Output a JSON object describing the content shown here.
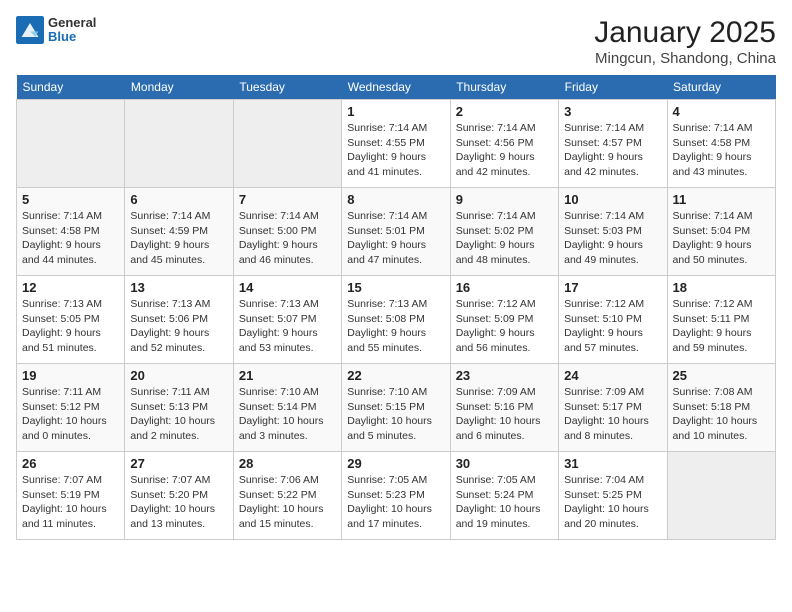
{
  "header": {
    "logo_general": "General",
    "logo_blue": "Blue",
    "month_title": "January 2025",
    "location": "Mingcun, Shandong, China"
  },
  "weekdays": [
    "Sunday",
    "Monday",
    "Tuesday",
    "Wednesday",
    "Thursday",
    "Friday",
    "Saturday"
  ],
  "weeks": [
    [
      {
        "day": "",
        "empty": true
      },
      {
        "day": "",
        "empty": true
      },
      {
        "day": "",
        "empty": true
      },
      {
        "day": "1",
        "sunrise": "7:14 AM",
        "sunset": "4:55 PM",
        "daylight": "9 hours and 41 minutes."
      },
      {
        "day": "2",
        "sunrise": "7:14 AM",
        "sunset": "4:56 PM",
        "daylight": "9 hours and 42 minutes."
      },
      {
        "day": "3",
        "sunrise": "7:14 AM",
        "sunset": "4:57 PM",
        "daylight": "9 hours and 42 minutes."
      },
      {
        "day": "4",
        "sunrise": "7:14 AM",
        "sunset": "4:58 PM",
        "daylight": "9 hours and 43 minutes."
      }
    ],
    [
      {
        "day": "5",
        "sunrise": "7:14 AM",
        "sunset": "4:58 PM",
        "daylight": "9 hours and 44 minutes."
      },
      {
        "day": "6",
        "sunrise": "7:14 AM",
        "sunset": "4:59 PM",
        "daylight": "9 hours and 45 minutes."
      },
      {
        "day": "7",
        "sunrise": "7:14 AM",
        "sunset": "5:00 PM",
        "daylight": "9 hours and 46 minutes."
      },
      {
        "day": "8",
        "sunrise": "7:14 AM",
        "sunset": "5:01 PM",
        "daylight": "9 hours and 47 minutes."
      },
      {
        "day": "9",
        "sunrise": "7:14 AM",
        "sunset": "5:02 PM",
        "daylight": "9 hours and 48 minutes."
      },
      {
        "day": "10",
        "sunrise": "7:14 AM",
        "sunset": "5:03 PM",
        "daylight": "9 hours and 49 minutes."
      },
      {
        "day": "11",
        "sunrise": "7:14 AM",
        "sunset": "5:04 PM",
        "daylight": "9 hours and 50 minutes."
      }
    ],
    [
      {
        "day": "12",
        "sunrise": "7:13 AM",
        "sunset": "5:05 PM",
        "daylight": "9 hours and 51 minutes."
      },
      {
        "day": "13",
        "sunrise": "7:13 AM",
        "sunset": "5:06 PM",
        "daylight": "9 hours and 52 minutes."
      },
      {
        "day": "14",
        "sunrise": "7:13 AM",
        "sunset": "5:07 PM",
        "daylight": "9 hours and 53 minutes."
      },
      {
        "day": "15",
        "sunrise": "7:13 AM",
        "sunset": "5:08 PM",
        "daylight": "9 hours and 55 minutes."
      },
      {
        "day": "16",
        "sunrise": "7:12 AM",
        "sunset": "5:09 PM",
        "daylight": "9 hours and 56 minutes."
      },
      {
        "day": "17",
        "sunrise": "7:12 AM",
        "sunset": "5:10 PM",
        "daylight": "9 hours and 57 minutes."
      },
      {
        "day": "18",
        "sunrise": "7:12 AM",
        "sunset": "5:11 PM",
        "daylight": "9 hours and 59 minutes."
      }
    ],
    [
      {
        "day": "19",
        "sunrise": "7:11 AM",
        "sunset": "5:12 PM",
        "daylight": "10 hours and 0 minutes."
      },
      {
        "day": "20",
        "sunrise": "7:11 AM",
        "sunset": "5:13 PM",
        "daylight": "10 hours and 2 minutes."
      },
      {
        "day": "21",
        "sunrise": "7:10 AM",
        "sunset": "5:14 PM",
        "daylight": "10 hours and 3 minutes."
      },
      {
        "day": "22",
        "sunrise": "7:10 AM",
        "sunset": "5:15 PM",
        "daylight": "10 hours and 5 minutes."
      },
      {
        "day": "23",
        "sunrise": "7:09 AM",
        "sunset": "5:16 PM",
        "daylight": "10 hours and 6 minutes."
      },
      {
        "day": "24",
        "sunrise": "7:09 AM",
        "sunset": "5:17 PM",
        "daylight": "10 hours and 8 minutes."
      },
      {
        "day": "25",
        "sunrise": "7:08 AM",
        "sunset": "5:18 PM",
        "daylight": "10 hours and 10 minutes."
      }
    ],
    [
      {
        "day": "26",
        "sunrise": "7:07 AM",
        "sunset": "5:19 PM",
        "daylight": "10 hours and 11 minutes."
      },
      {
        "day": "27",
        "sunrise": "7:07 AM",
        "sunset": "5:20 PM",
        "daylight": "10 hours and 13 minutes."
      },
      {
        "day": "28",
        "sunrise": "7:06 AM",
        "sunset": "5:22 PM",
        "daylight": "10 hours and 15 minutes."
      },
      {
        "day": "29",
        "sunrise": "7:05 AM",
        "sunset": "5:23 PM",
        "daylight": "10 hours and 17 minutes."
      },
      {
        "day": "30",
        "sunrise": "7:05 AM",
        "sunset": "5:24 PM",
        "daylight": "10 hours and 19 minutes."
      },
      {
        "day": "31",
        "sunrise": "7:04 AM",
        "sunset": "5:25 PM",
        "daylight": "10 hours and 20 minutes."
      },
      {
        "day": "",
        "empty": true
      }
    ]
  ]
}
